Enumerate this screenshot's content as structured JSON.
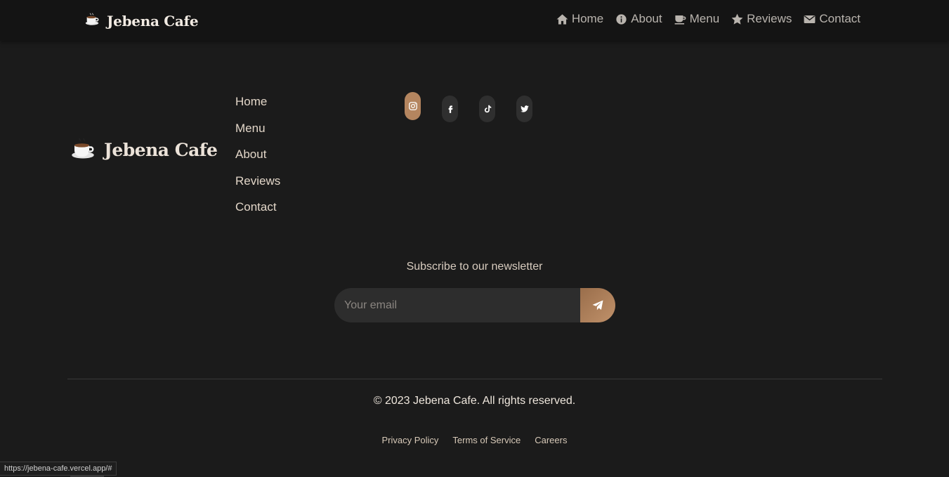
{
  "navbar": {
    "brand": "Jebena Cafe",
    "items": [
      {
        "label": "Home",
        "icon": "home-icon"
      },
      {
        "label": "About",
        "icon": "info-icon"
      },
      {
        "label": "Menu",
        "icon": "coffee-cup-icon"
      },
      {
        "label": "Reviews",
        "icon": "star-icon"
      },
      {
        "label": "Contact",
        "icon": "envelope-icon"
      }
    ]
  },
  "footer": {
    "brand": "Jebena Cafe",
    "links": [
      "Home",
      "Menu",
      "About",
      "Reviews",
      "Contact"
    ],
    "social": [
      "instagram-icon",
      "facebook-icon",
      "tiktok-icon",
      "twitter-icon"
    ],
    "newsletter": {
      "title": "Subscribe to our newsletter",
      "placeholder": "Your email"
    },
    "copyright": "© 2023 Jebena Cafe. All rights reserved.",
    "legal": [
      "Privacy Policy",
      "Terms of Service",
      "Careers"
    ]
  },
  "status_url": "https://jebena-cafe.vercel.app/#",
  "colors": {
    "background": "#1b1b1b",
    "navbar": "#141414",
    "accent": "#b4855f"
  }
}
